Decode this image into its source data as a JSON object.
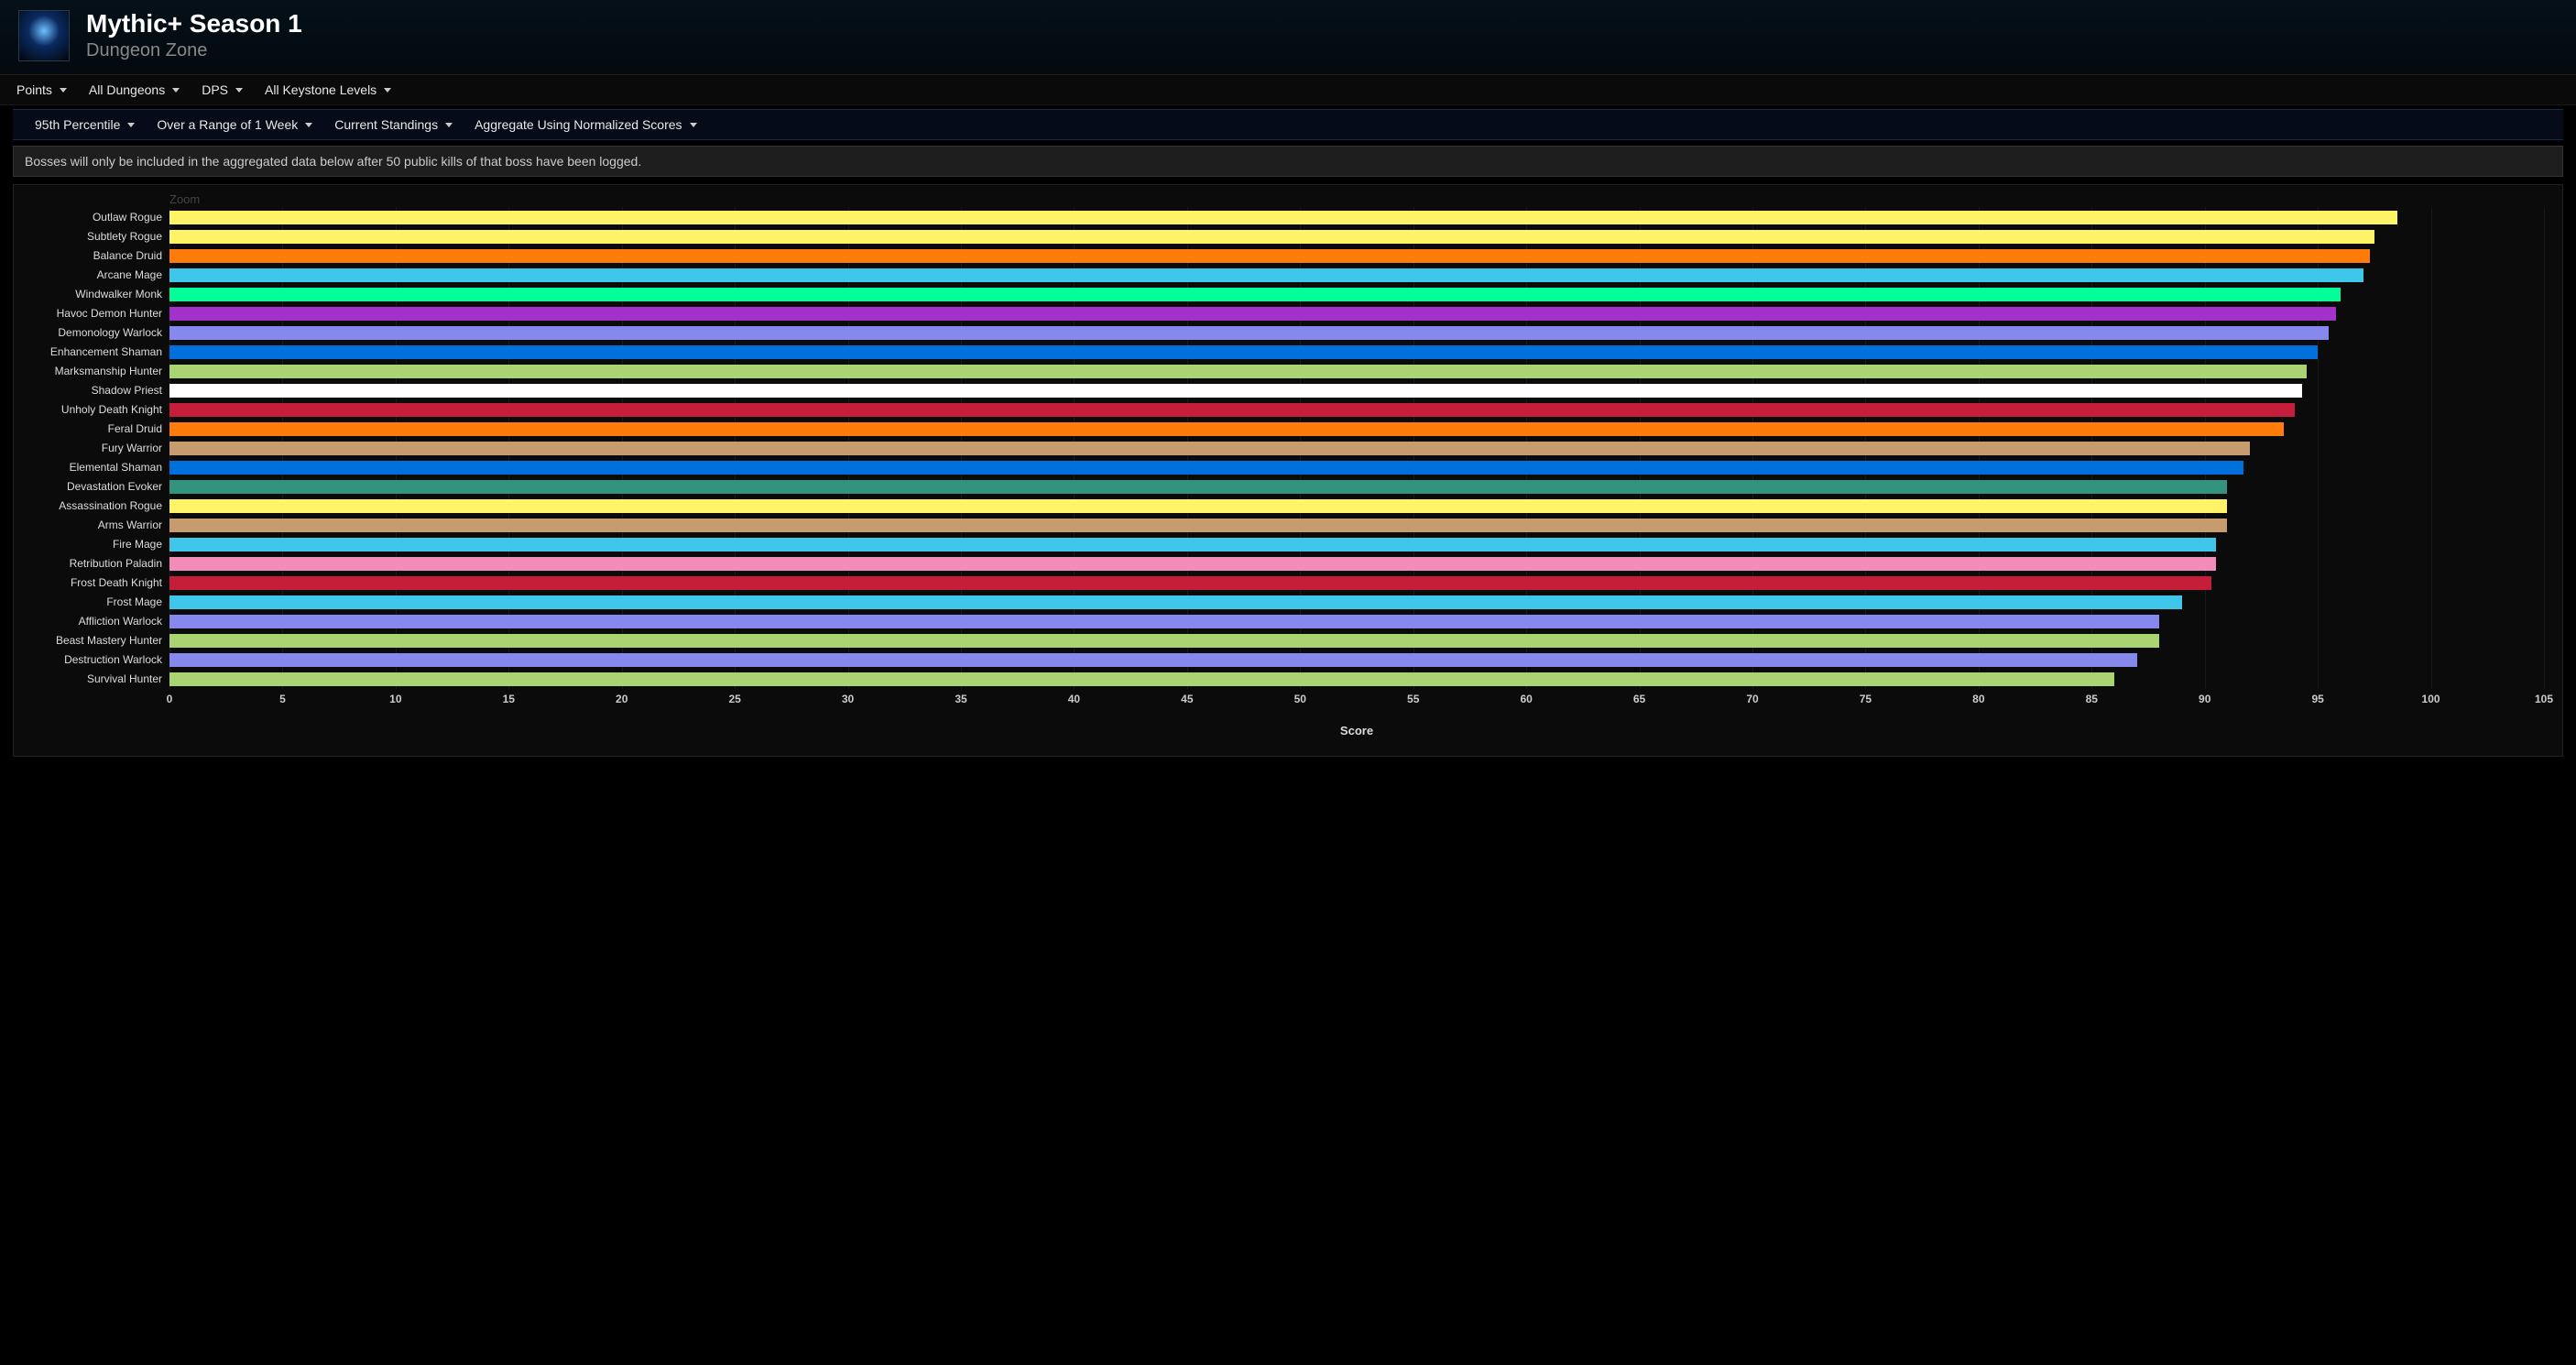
{
  "header": {
    "title": "Mythic+ Season 1",
    "subtitle": "Dungeon Zone"
  },
  "filters_primary": [
    {
      "label": "Points"
    },
    {
      "label": "All Dungeons"
    },
    {
      "label": "DPS"
    },
    {
      "label": "All Keystone Levels"
    }
  ],
  "filters_secondary": [
    {
      "label": "95th Percentile"
    },
    {
      "label": "Over a Range of 1 Week"
    },
    {
      "label": "Current Standings"
    },
    {
      "label": "Aggregate Using Normalized Scores"
    }
  ],
  "notice": "Bosses will only be included in the aggregated data below after 50 public kills of that boss have been logged.",
  "zoom_label": "Zoom",
  "chart_data": {
    "type": "bar",
    "orientation": "horizontal",
    "xlabel": "Score",
    "ylabel": "",
    "xlim": [
      0,
      105
    ],
    "xticks": [
      0,
      5,
      10,
      15,
      20,
      25,
      30,
      35,
      40,
      45,
      50,
      55,
      60,
      65,
      70,
      75,
      80,
      85,
      90,
      95,
      100,
      105
    ],
    "series": [
      {
        "name": "Outlaw Rogue",
        "value": 98.5,
        "color": "#fff468"
      },
      {
        "name": "Subtlety Rogue",
        "value": 97.5,
        "color": "#fff468"
      },
      {
        "name": "Balance Druid",
        "value": 97.3,
        "color": "#ff7c0a"
      },
      {
        "name": "Arcane Mage",
        "value": 97.0,
        "color": "#3fc7eb"
      },
      {
        "name": "Windwalker Monk",
        "value": 96.0,
        "color": "#00ff98"
      },
      {
        "name": "Havoc Demon Hunter",
        "value": 95.8,
        "color": "#a330c9"
      },
      {
        "name": "Demonology Warlock",
        "value": 95.5,
        "color": "#8788ee"
      },
      {
        "name": "Enhancement Shaman",
        "value": 95.0,
        "color": "#0070dd"
      },
      {
        "name": "Marksmanship Hunter",
        "value": 94.5,
        "color": "#aad372"
      },
      {
        "name": "Shadow Priest",
        "value": 94.3,
        "color": "#ffffff"
      },
      {
        "name": "Unholy Death Knight",
        "value": 94.0,
        "color": "#c41e3a"
      },
      {
        "name": "Feral Druid",
        "value": 93.5,
        "color": "#ff7c0a"
      },
      {
        "name": "Fury Warrior",
        "value": 92.0,
        "color": "#c69b6d"
      },
      {
        "name": "Elemental Shaman",
        "value": 91.7,
        "color": "#0070dd"
      },
      {
        "name": "Devastation Evoker",
        "value": 91.0,
        "color": "#33937f"
      },
      {
        "name": "Assassination Rogue",
        "value": 91.0,
        "color": "#fff468"
      },
      {
        "name": "Arms Warrior",
        "value": 91.0,
        "color": "#c69b6d"
      },
      {
        "name": "Fire Mage",
        "value": 90.5,
        "color": "#3fc7eb"
      },
      {
        "name": "Retribution Paladin",
        "value": 90.5,
        "color": "#f48cba"
      },
      {
        "name": "Frost Death Knight",
        "value": 90.3,
        "color": "#c41e3a"
      },
      {
        "name": "Frost Mage",
        "value": 89.0,
        "color": "#3fc7eb"
      },
      {
        "name": "Affliction Warlock",
        "value": 88.0,
        "color": "#8788ee"
      },
      {
        "name": "Beast Mastery Hunter",
        "value": 88.0,
        "color": "#aad372"
      },
      {
        "name": "Destruction Warlock",
        "value": 87.0,
        "color": "#8788ee"
      },
      {
        "name": "Survival Hunter",
        "value": 86.0,
        "color": "#aad372"
      }
    ]
  }
}
